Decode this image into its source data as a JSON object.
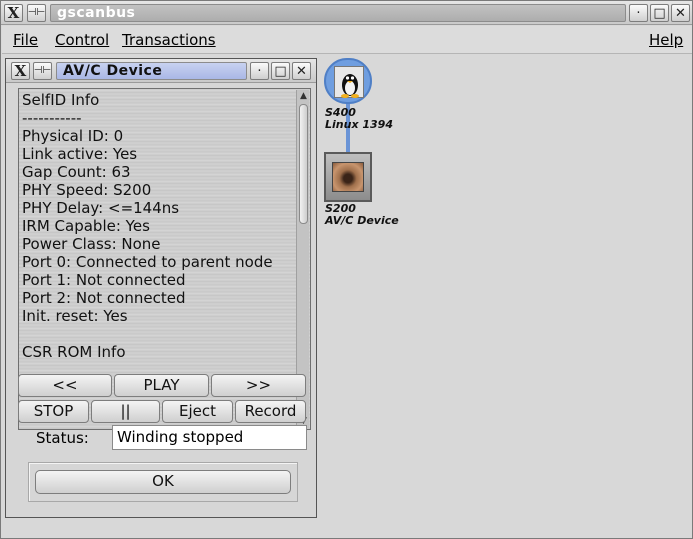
{
  "window": {
    "title": "gscanbus",
    "close_icon_glyph": "X",
    "pin_icon_glyph": "⊣⊢",
    "minimize_glyph": "·",
    "maximize_glyph": "□",
    "close_glyph": "✕"
  },
  "menubar": {
    "file": "File",
    "control": "Control",
    "transactions": "Transactions",
    "help": "Help"
  },
  "dialog": {
    "title": "AV/C Device",
    "info_lines": [
      "SelfID Info",
      "-----------",
      "Physical ID: 0",
      "Link active: Yes",
      "Gap Count: 63",
      "PHY Speed: S200",
      "PHY Delay: <=144ns",
      "IRM Capable: Yes",
      "Power Class: None",
      "Port 0: Connected to parent node",
      "Port 1: Not connected",
      "Port 2: Not connected",
      "Init. reset: Yes",
      "",
      "CSR ROM Info"
    ],
    "buttons": {
      "rewind": "<<",
      "play": "PLAY",
      "forward": ">>",
      "stop": "STOP",
      "pause": "||",
      "eject": "Eject",
      "record": "Record",
      "ok": "OK"
    },
    "status_label": "Status:",
    "status_value": "Winding stopped"
  },
  "topology": {
    "nodes": [
      {
        "speed": "S400",
        "name": "Linux 1394",
        "icon": "linux-penguin-icon"
      },
      {
        "speed": "S200",
        "name": "AV/C Device",
        "icon": "camera-eye-icon"
      }
    ]
  },
  "colors": {
    "link_line": "#6a94d6",
    "pc_node_bg": "#6f9ee0",
    "status_bg": "#ffffff"
  }
}
